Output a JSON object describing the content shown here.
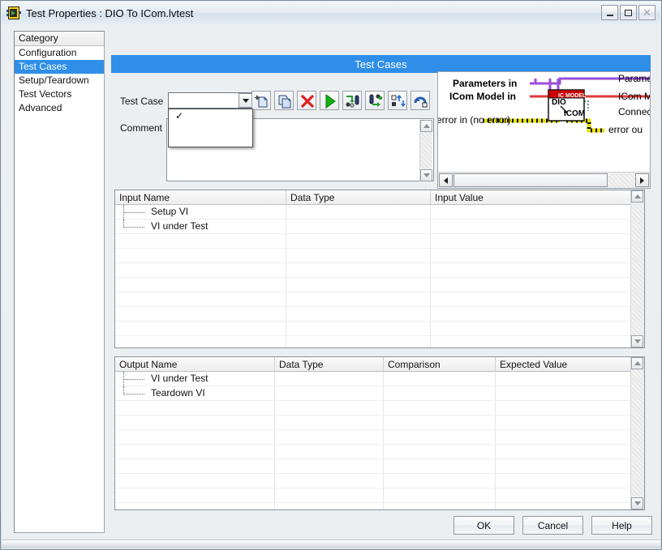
{
  "window": {
    "title": "Test Properties : DIO To ICom.lvtest",
    "icon": "labview-vi-icon",
    "buttons": {
      "minimize": "minimize-button",
      "maximize": "maximize-button",
      "close": "close-button"
    }
  },
  "category": {
    "header": "Category",
    "items": [
      {
        "label": "Configuration",
        "selected": false
      },
      {
        "label": "Test Cases",
        "selected": true
      },
      {
        "label": "Setup/Teardown",
        "selected": false
      },
      {
        "label": "Test Vectors",
        "selected": false
      },
      {
        "label": "Advanced",
        "selected": false
      }
    ]
  },
  "banner": {
    "title": "Test Cases",
    "color": "#2f8fe8"
  },
  "test_case": {
    "label": "Test Case",
    "value": "",
    "dropdown_open": true,
    "options": [
      {
        "label": "",
        "checked": true,
        "check_glyph": "✓"
      }
    ]
  },
  "toolbar": {
    "buttons": [
      {
        "name": "new-test-case-button",
        "tip": "New Test Case"
      },
      {
        "name": "copy-test-case-button",
        "tip": "Copy Test Case"
      },
      {
        "name": "delete-test-case-button",
        "tip": "Delete Test Case"
      },
      {
        "name": "run-test-case-button",
        "tip": "Run Test Case"
      },
      {
        "name": "import-values-button",
        "tip": "Import Values"
      },
      {
        "name": "export-values-button",
        "tip": "Export Values"
      },
      {
        "name": "reorder-test-cases-button",
        "tip": "Reorder Test Cases"
      },
      {
        "name": "revert-button",
        "tip": "Revert"
      }
    ]
  },
  "comment": {
    "label": "Comment",
    "value": ""
  },
  "diagram": {
    "left_labels": [
      "Parameters in",
      "ICom Model in",
      "error in (no error)"
    ],
    "right_labels": [
      "Parame",
      "ICom M",
      "Connec",
      "error ou"
    ],
    "vi_icon": {
      "banner": "IC MODEL",
      "line1": "DIO",
      "line2": "ICOM"
    },
    "wire_colors": {
      "parameters": "#9b4edb",
      "icom_model": "#e03a3a",
      "error": "#e8e000",
      "connector": "#1f7a3f"
    }
  },
  "input_table": {
    "columns": [
      "Input Name",
      "Data Type",
      "Input Value"
    ],
    "rows": [
      {
        "name": "Setup VI",
        "data_type": "",
        "value": ""
      },
      {
        "name": "VI under Test",
        "data_type": "",
        "value": ""
      }
    ],
    "empty_rows": 8
  },
  "output_table": {
    "columns": [
      "Output Name",
      "Data Type",
      "Comparison",
      "Expected Value"
    ],
    "rows": [
      {
        "name": "VI under Test",
        "data_type": "",
        "comparison": "",
        "expected": ""
      },
      {
        "name": "Teardown VI",
        "data_type": "",
        "comparison": "",
        "expected": ""
      }
    ],
    "empty_rows": 8
  },
  "footer": {
    "ok": "OK",
    "cancel": "Cancel",
    "help": "Help"
  }
}
